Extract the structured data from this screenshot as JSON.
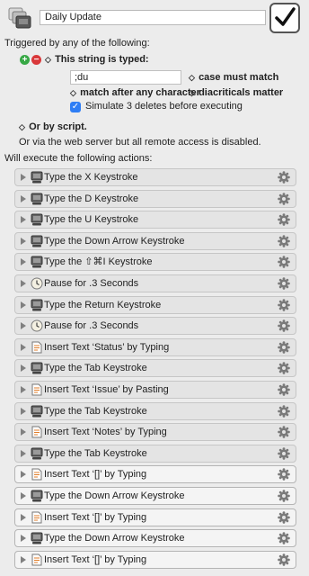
{
  "macro": {
    "name": "Daily Update",
    "enabled_checkmark": "✓"
  },
  "triggers": {
    "heading": "Triggered by any of the following:",
    "add_symbol": "+",
    "remove_symbol": "−",
    "updown_symbol": "◇",
    "typed_string_label": "This string is typed:",
    "typed_string_value": ";du",
    "case_label": "case must match",
    "match_label": "match after any character",
    "diacriticals_label": "diacriticals matter",
    "simulate_label": "Simulate 3 deletes before executing",
    "simulate_checked": true,
    "script_label": "Or by script.",
    "webserver_text": "Or via the web server but all remote access is disabled."
  },
  "actions_heading": "Will execute the following actions:",
  "actions": [
    {
      "label": "Type the X Keystroke",
      "icon": "keyboard-icon"
    },
    {
      "label": "Type the D Keystroke",
      "icon": "keyboard-icon"
    },
    {
      "label": "Type the U Keystroke",
      "icon": "keyboard-icon"
    },
    {
      "label": "Type the Down Arrow Keystroke",
      "icon": "keyboard-icon"
    },
    {
      "label": "Type the ⇧⌘I Keystroke",
      "icon": "keyboard-icon"
    },
    {
      "label": "Pause for .3 Seconds",
      "icon": "clock-icon"
    },
    {
      "label": "Type the Return Keystroke",
      "icon": "keyboard-icon"
    },
    {
      "label": "Pause for .3 Seconds",
      "icon": "clock-icon"
    },
    {
      "label": "Insert Text ‘Status’ by Typing",
      "icon": "text-doc-icon"
    },
    {
      "label": "Type the Tab Keystroke",
      "icon": "keyboard-icon"
    },
    {
      "label": "Insert Text ‘Issue’ by Pasting",
      "icon": "text-doc-icon"
    },
    {
      "label": "Type the Tab Keystroke",
      "icon": "keyboard-icon"
    },
    {
      "label": "Insert Text ‘Notes’ by Typing",
      "icon": "text-doc-icon"
    },
    {
      "label": "Type the Tab Keystroke",
      "icon": "keyboard-icon"
    },
    {
      "label": "Insert Text ‘[]’ by Typing",
      "icon": "text-doc-icon"
    },
    {
      "label": "Type the Down Arrow Keystroke",
      "icon": "keyboard-icon"
    },
    {
      "label": "Insert Text ‘[]’ by Typing",
      "icon": "text-doc-icon"
    },
    {
      "label": "Type the Down Arrow Keystroke",
      "icon": "keyboard-icon"
    },
    {
      "label": "Insert Text ‘[]’ by Typing",
      "icon": "text-doc-icon"
    }
  ]
}
